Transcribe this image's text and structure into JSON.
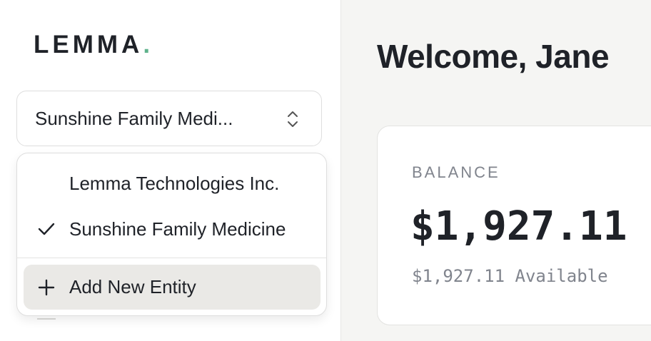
{
  "sidebar": {
    "logo": {
      "text": "LEMMA",
      "dot": ".",
      "dot_color": "#5fb38c"
    },
    "entity_selector": {
      "selected_label": "Sunshine Family Medi...",
      "icon": "chevron-up-down-icon"
    },
    "entity_dropdown": {
      "options": [
        {
          "label": "Lemma Technologies Inc.",
          "selected": false
        },
        {
          "label": "Sunshine Family Medicine",
          "selected": true,
          "icon": "check-icon"
        }
      ],
      "add_action": {
        "label": "Add New Entity",
        "icon": "plus-icon"
      }
    }
  },
  "main": {
    "greeting": "Welcome, Jane",
    "balance_card": {
      "label": "BALANCE",
      "amount": "$1,927.11",
      "available": "$1,927.11 Available"
    }
  },
  "colors": {
    "accent": "#5fb38c",
    "text": "#1f2228",
    "muted": "#80848d",
    "main_background": "#f5f5f3",
    "highlight": "#eae9e6"
  }
}
